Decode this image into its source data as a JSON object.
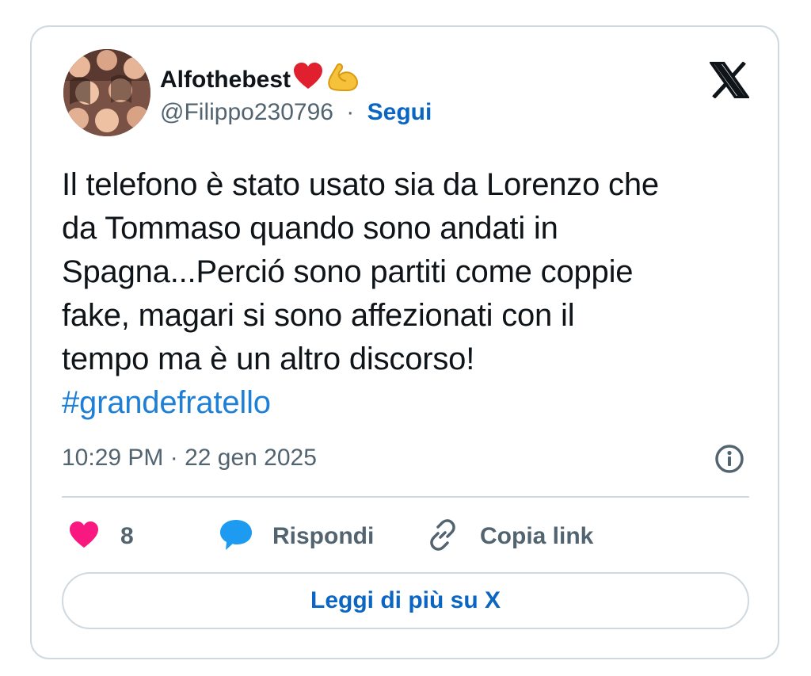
{
  "author": {
    "display_name": "Alfothebest",
    "emoji": [
      "red-heart",
      "flexed-biceps"
    ],
    "handle": "@Filippo230796",
    "separator": "·",
    "follow_label": "Segui"
  },
  "tweet": {
    "lines": [
      "Il telefono è stato usato sia da Lorenzo che",
      "da Tommaso quando sono andati in",
      "Spagna...Perció sono partiti come coppie",
      "fake, magari si sono affezionati con il",
      "tempo ma è un altro discorso!"
    ],
    "hashtag": "#grandefratello",
    "timestamp": "10:29 PM · 22 gen 2025"
  },
  "actions": {
    "like_count": "8",
    "reply_label": "Rispondi",
    "copy_link_label": "Copia link"
  },
  "read_more_label": "Leggi di più su X",
  "colors": {
    "link_blue": "#0a66c2",
    "hashtag_blue": "#1d7fd6",
    "like_pink": "#f91880",
    "reply_blue": "#1d9bf0",
    "muted_gray": "#536471",
    "border": "#cfd9de"
  },
  "icons": {
    "platform_logo": "x-logo-icon",
    "info": "info-icon",
    "like": "heart-icon",
    "reply": "speech-bubble-icon",
    "copy_link": "link-icon"
  }
}
